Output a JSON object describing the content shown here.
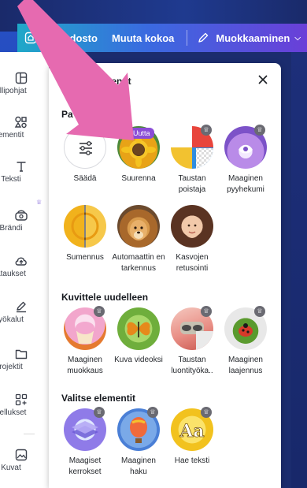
{
  "topbar": {
    "file_label": "Tiedosto",
    "resize_label": "Muuta kokoa",
    "edit_label": "Muokkaaminen"
  },
  "sidebar": {
    "items": [
      {
        "label": "allipohjat",
        "icon": "template-icon"
      },
      {
        "label": "ementit",
        "icon": "elements-icon"
      },
      {
        "label": "Teksti",
        "icon": "text-icon"
      },
      {
        "label": "Brändi",
        "icon": "brand-icon"
      },
      {
        "label": "ataukset",
        "icon": "upload-icon"
      },
      {
        "label": "yökalut",
        "icon": "tools-icon"
      },
      {
        "label": "rojektit",
        "icon": "folder-icon"
      },
      {
        "label": "vellukset",
        "icon": "apps-icon"
      },
      {
        "label": "Kuvat",
        "icon": "photos-icon"
      }
    ]
  },
  "panel": {
    "title": "ementit",
    "title_prefix": "Ku",
    "sections": [
      {
        "title": "Pa",
        "tools": [
          {
            "label": "Säädä"
          },
          {
            "label": "Suurenna",
            "badge": "Uutta"
          },
          {
            "label": "Taustan poistaja"
          },
          {
            "label": "Maaginen pyyhekumi"
          },
          {
            "label": "Sumennus"
          },
          {
            "label": "Automaattin en tarkennus"
          },
          {
            "label": "Kasvojen retusointi"
          }
        ]
      },
      {
        "title": "Kuvittele uudelleen",
        "tools": [
          {
            "label": "Maaginen muokkaus"
          },
          {
            "label": "Kuva videoksi"
          },
          {
            "label": "Taustan luontityöka.."
          },
          {
            "label": "Maaginen laajennus"
          }
        ]
      },
      {
        "title": "Valitse elementit",
        "tools": [
          {
            "label": "Maagiset kerrokset"
          },
          {
            "label": "Maaginen haku"
          },
          {
            "label": "Hae teksti"
          }
        ]
      }
    ]
  },
  "colors": {
    "accent_purple": "#8a4cd6",
    "arrow_pink": "#e66ab0"
  }
}
